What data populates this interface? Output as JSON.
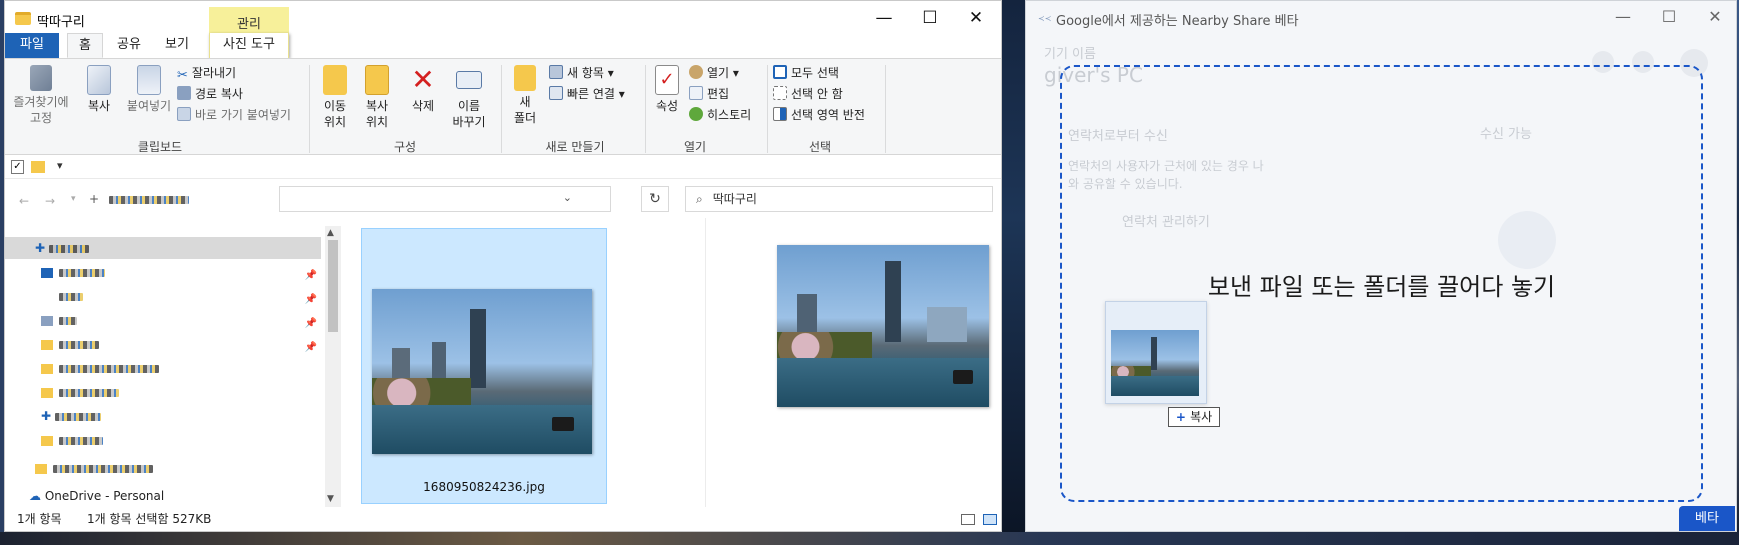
{
  "explorer": {
    "window_title": "딱따구리",
    "contextual_tab_group": "관리",
    "window_buttons": {
      "minimize": "—",
      "maximize": "☐",
      "close": "✕"
    },
    "tabs": [
      {
        "label": "파일"
      },
      {
        "label": "홈"
      },
      {
        "label": "공유"
      },
      {
        "label": "보기"
      },
      {
        "label": "사진 도구"
      }
    ],
    "ribbon": {
      "clipboard": {
        "pin_label": "즐겨찾기에\n고정",
        "copy_label": "복사",
        "paste_label": "붙여넣기",
        "cut_label": "잘라내기",
        "copy_path_label": "경로 복사",
        "paste_shortcut_label": "바로 가기 붙여넣기",
        "group_label": "클립보드"
      },
      "organize": {
        "move_to_label": "이동\n위치",
        "copy_to_label": "복사\n위치",
        "delete_label": "삭제",
        "rename_label": "이름\n바꾸기",
        "group_label": "구성"
      },
      "new": {
        "new_folder_label": "새\n폴더",
        "new_item_label": "새 항목",
        "easy_access_label": "빠른 연결",
        "group_label": "새로 만들기"
      },
      "open": {
        "properties_label": "속성",
        "open_label": "열기",
        "edit_label": "편집",
        "history_label": "히스토리",
        "group_label": "열기"
      },
      "select": {
        "select_all_label": "모두 선택",
        "select_none_label": "선택 안 함",
        "invert_label": "선택 영역 반전",
        "group_label": "선택"
      }
    },
    "search_placeholder": "딱따구리",
    "refresh_icon": "↻",
    "files": [
      {
        "name": "1680950824236.jpg",
        "selected": true
      }
    ],
    "status": {
      "item_count": "1개 항목",
      "selection": "1개 항목 선택함 527KB"
    },
    "nav_onedrive": "OneDrive - Personal"
  },
  "nearby": {
    "window_title": "Google에서 제공하는 Nearby Share 베타",
    "device_label": "기기 이름",
    "device_name": "giver's PC",
    "receive_from": "연락처로부터 수신",
    "receive_state": "수신 가능",
    "contacts_note": "연락처의 사용자가 근처에 있는 경우 나\n와 공유할 수 있습니다.",
    "manage_contacts": "연락처 관리하기",
    "drop_prompt": "보낸 파일 또는 폴더를 끌어다 놓기",
    "copy_badge": "복사",
    "beta_badge": "베타"
  },
  "colors": {
    "accent_blue": "#1e63b6",
    "nearby_blue": "#1a56c8",
    "selection_fill": "#cce8ff",
    "contextual_yellow": "#f7f09a"
  }
}
